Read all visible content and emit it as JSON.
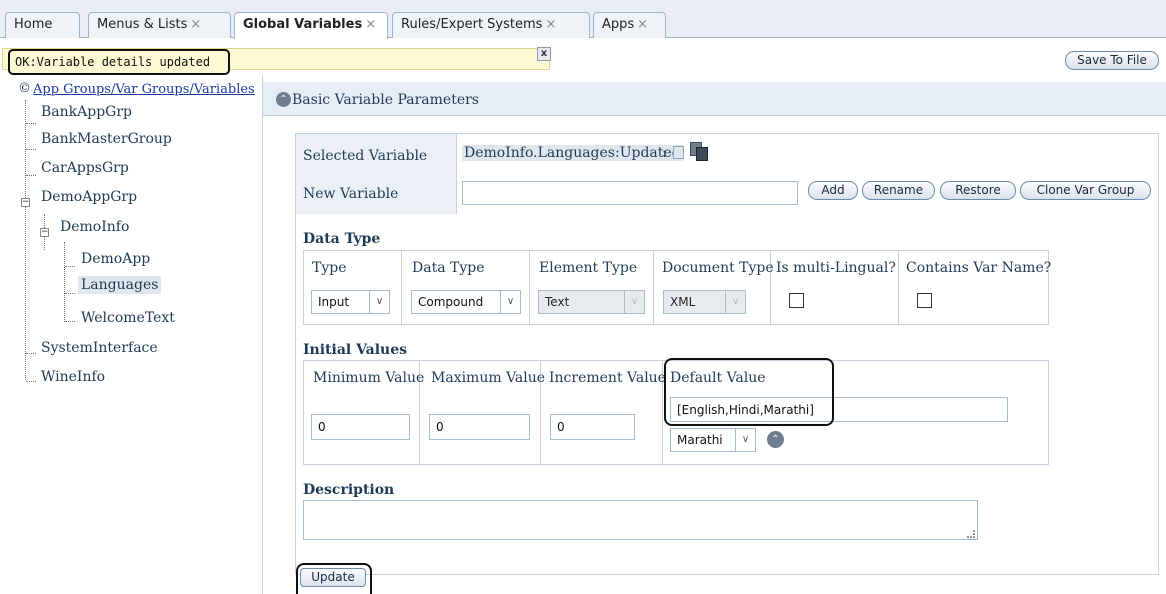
{
  "tabs": [
    {
      "label": "Home",
      "closable": false
    },
    {
      "label": "Menus & Lists",
      "closable": true
    },
    {
      "label": "Global Variables",
      "closable": true,
      "active": true
    },
    {
      "label": "Rules/Expert Systems",
      "closable": true
    },
    {
      "label": "Apps",
      "closable": true
    }
  ],
  "tab_close_glyph": "×",
  "status": {
    "message": "OK:Variable details updated",
    "close_label": "x"
  },
  "save_to_file_label": "Save To File",
  "tree": {
    "root_label": "App Groups/Var Groups/Variables",
    "items": {
      "bankappgrp": "BankAppGrp",
      "bankmastergroup": "BankMasterGroup",
      "carappsgrp": "CarAppsGrp",
      "demoappgrp": "DemoAppGrp",
      "demoinfo": "DemoInfo",
      "demoapp": "DemoApp",
      "languages": "Languages",
      "welcometext": "WelcomeText",
      "systeminterface": "SystemInterface",
      "wineinfo": "WineInfo"
    },
    "expanded_glyph": "−",
    "root_icon_glyph": "©"
  },
  "section": {
    "title": "Basic Variable Parameters",
    "collapse_glyph": "⌃"
  },
  "variable": {
    "selected_label": "Selected Variable",
    "selected_value": "DemoInfo.Languages:Updated",
    "selected_suffix": ":",
    "new_label": "New Variable",
    "new_value": "",
    "buttons": {
      "add": "Add",
      "rename": "Rename",
      "restore": "Restore",
      "clone": "Clone Var Group"
    }
  },
  "data_type": {
    "heading": "Data Type",
    "columns": {
      "type": "Type",
      "data_type": "Data Type",
      "element_type": "Element Type",
      "document_type": "Document Type",
      "multilingual": "Is multi-Lingual?",
      "contains_var_name": "Contains Var Name?"
    },
    "values": {
      "type": "Input",
      "data_type": "Compound",
      "element_type": "Text",
      "document_type": "XML",
      "multilingual": false,
      "contains_var_name": false
    },
    "arrow_glyph": "∨"
  },
  "initial_values": {
    "heading": "Initial Values",
    "columns": {
      "min": "Minimum Value",
      "max": "Maximum Value",
      "increment": "Increment Value",
      "default": "Default Value"
    },
    "values": {
      "min": "0",
      "max": "0",
      "increment": "0",
      "default": "[English,Hindi,Marathi]",
      "default_select": "Marathi"
    }
  },
  "description": {
    "heading": "Description",
    "value": ""
  },
  "update_label": "Update"
}
